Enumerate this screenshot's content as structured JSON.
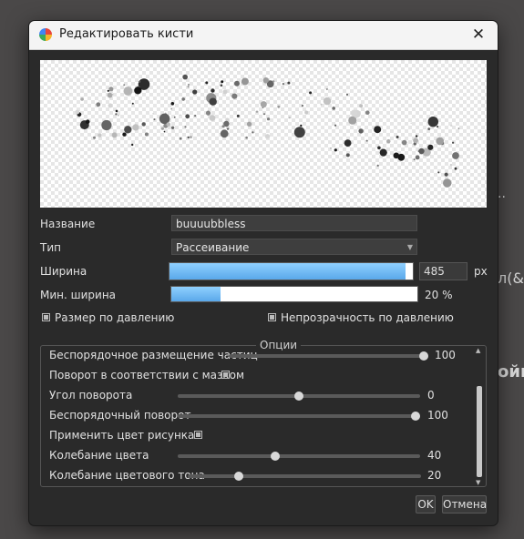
{
  "background": {
    "text_1": "..",
    "text_2": "л(&",
    "text_3": "ойк"
  },
  "dialog": {
    "title": "Редактировать кисти",
    "close_glyph": "✕"
  },
  "form": {
    "name_label": "Название",
    "name_value": "buuuubbless",
    "type_label": "Тип",
    "type_value": "Рассеивание",
    "width_label": "Ширина",
    "width_value": "485",
    "width_unit": "px",
    "width_fraction": 0.97,
    "min_width_label": "Мин. ширина",
    "min_width_value": "20 %",
    "min_width_fraction": 0.2,
    "size_pressure_label": "Размер по давлению",
    "size_pressure_checked": true,
    "opacity_pressure_label": "Непрозрачность по давлению",
    "opacity_pressure_checked": true
  },
  "options": {
    "title": "Опции",
    "rows": [
      {
        "label": "Беспорядочное размещение частиц",
        "type": "slider",
        "value": "100",
        "fraction": 1.0
      },
      {
        "label": "Поворот в соответствии с мазком",
        "type": "checkbox",
        "checked": true
      },
      {
        "label": "Угол поворота",
        "type": "slider",
        "value": "0",
        "fraction": 0.5
      },
      {
        "label": "Беспорядочный поворот",
        "type": "slider",
        "value": "100",
        "fraction": 1.0
      },
      {
        "label": "Применить цвет рисунка",
        "type": "checkbox",
        "checked": true
      },
      {
        "label": "Колебание цвета",
        "type": "slider",
        "value": "40",
        "fraction": 0.4
      },
      {
        "label": "Колебание цветового тона",
        "type": "slider",
        "value": "20",
        "fraction": 0.2
      }
    ]
  },
  "buttons": {
    "ok": "OK",
    "cancel": "Отмена"
  },
  "colors": {
    "accent": "#5aa8ea",
    "dialog_bg": "#2a2a2a"
  }
}
